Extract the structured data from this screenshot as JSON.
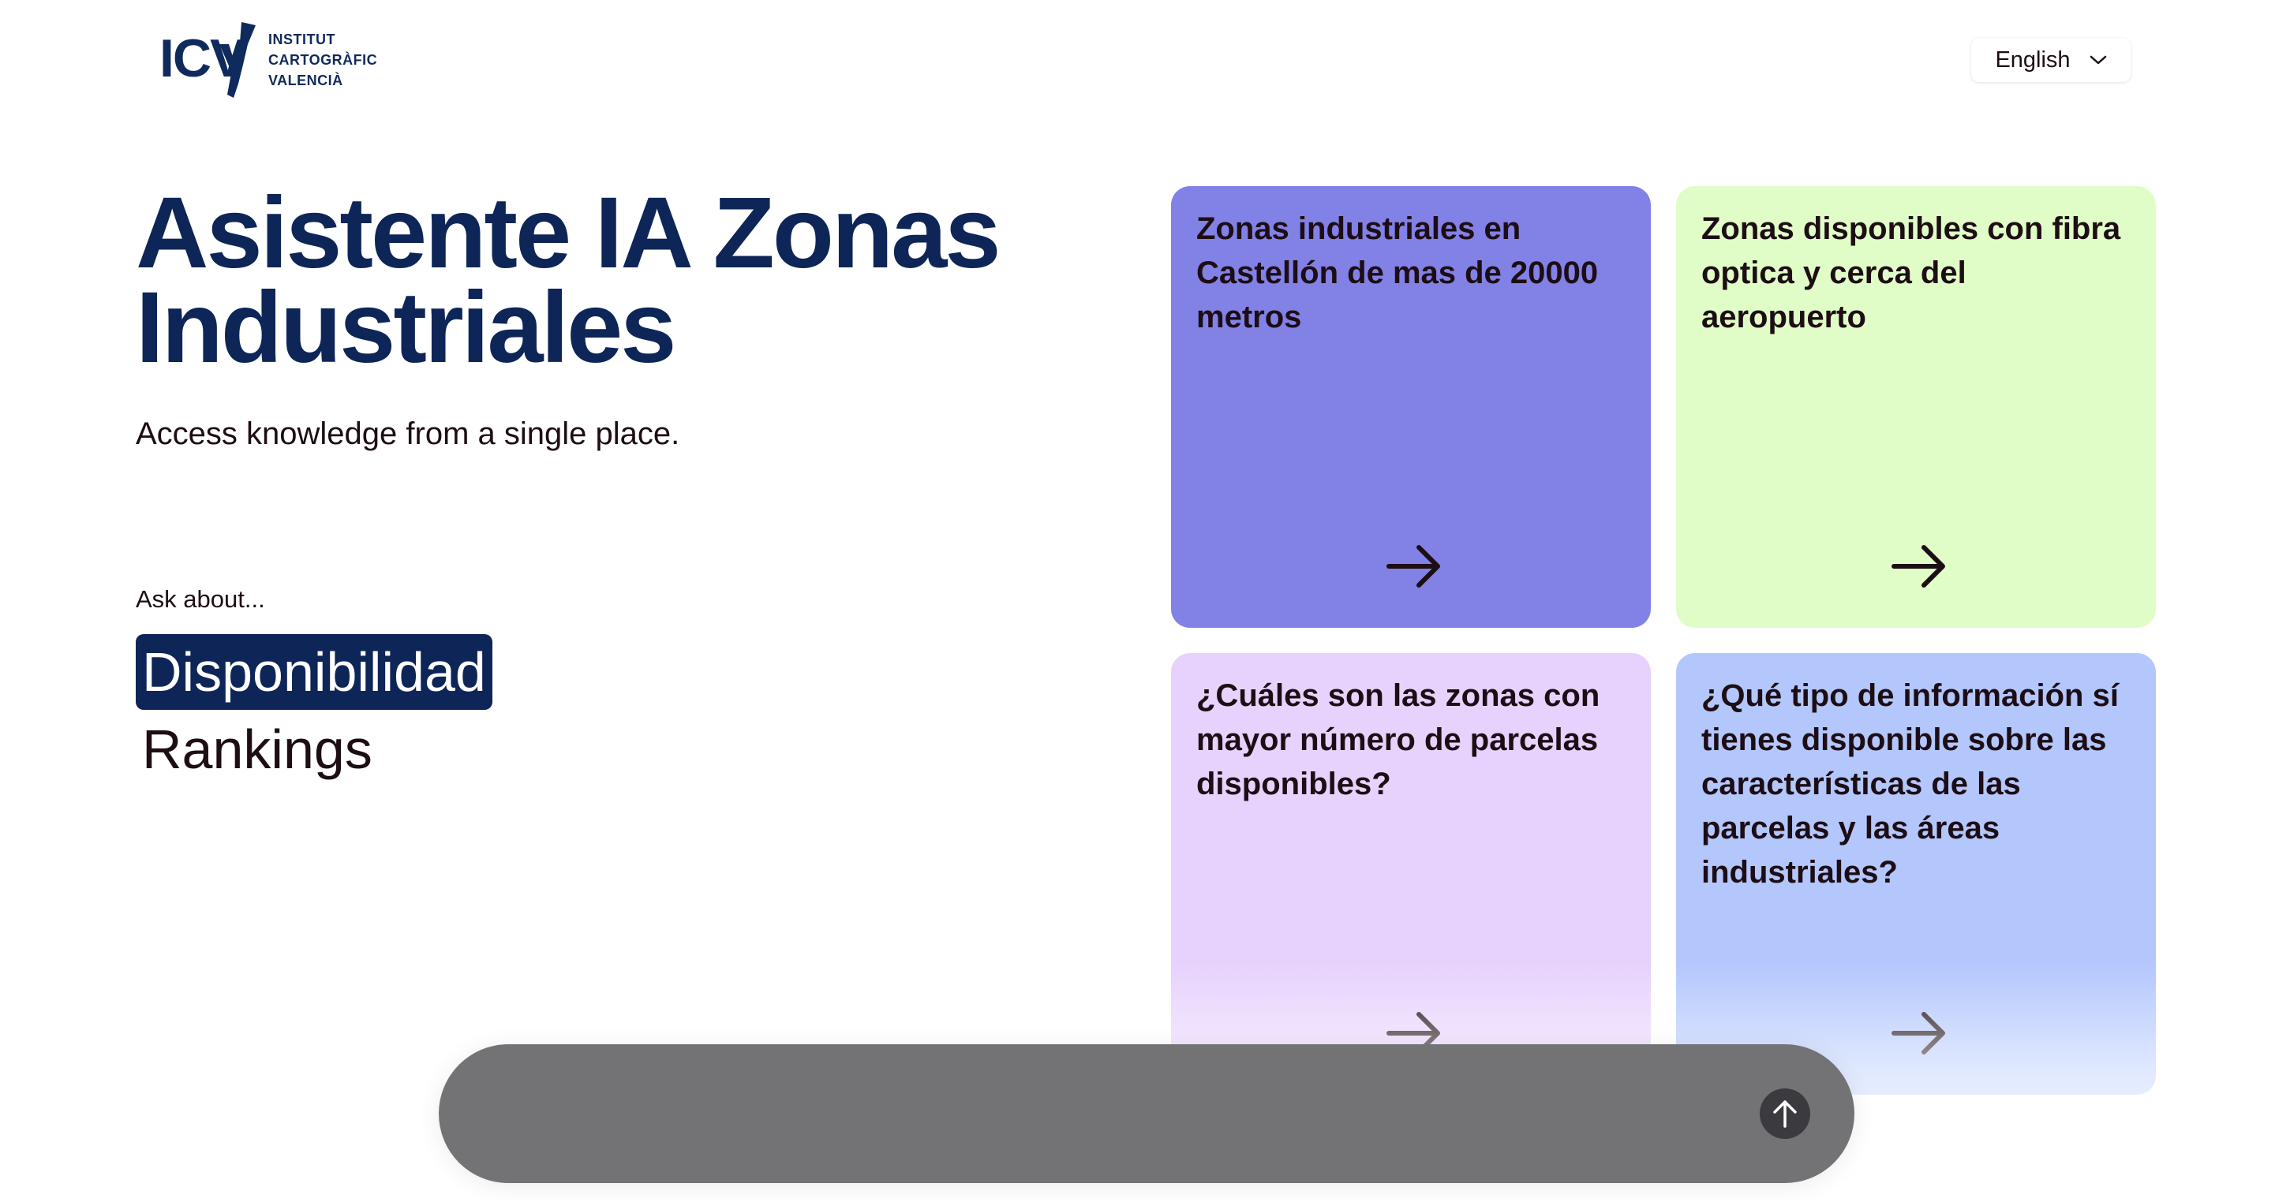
{
  "logo": {
    "mark": "ICV",
    "text_lines": [
      "INSTITUT",
      "CARTOGRÀFIC",
      "VALENCIÀ"
    ]
  },
  "language": {
    "selected": "English",
    "icon": "chevron-down-icon"
  },
  "hero": {
    "title": "Asistente IA Zonas Industriales",
    "subtitle": "Access knowledge from a single place."
  },
  "ask": {
    "label": "Ask about...",
    "topics": [
      {
        "label": "Disponibilidad",
        "active": true
      },
      {
        "label": "Rankings",
        "active": false
      }
    ]
  },
  "cards": [
    {
      "text": "Zonas industriales en Castellón de mas de 20000 metros",
      "color": "#8181e6",
      "icon": "arrow-right-icon"
    },
    {
      "text": "Zonas disponibles con fibra optica y cerca del aeropuerto",
      "color": "#e0fdc7",
      "icon": "arrow-right-icon"
    },
    {
      "text": "¿Cuáles son las zonas con mayor número de parcelas disponibles?",
      "color": "#e7d2fd",
      "icon": "arrow-right-icon"
    },
    {
      "text": "¿Qué tipo de información sí tienes disponible sobre las características de las parcelas y las áreas industriales?",
      "color": "#b3c7fd",
      "icon": "arrow-right-icon"
    }
  ],
  "chat": {
    "value": "",
    "send_icon": "arrow-up-icon"
  },
  "colors": {
    "brand_navy": "#0e2558",
    "chat_bg": "#737275",
    "send_button": "#3b3b3f"
  }
}
